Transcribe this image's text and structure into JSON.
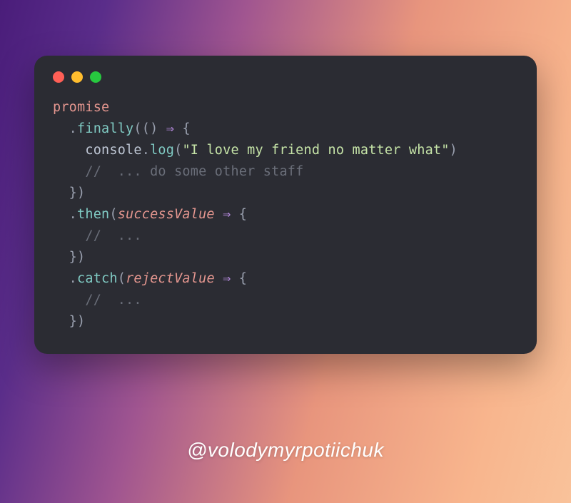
{
  "window": {
    "controls": [
      "red",
      "yellow",
      "green"
    ]
  },
  "code": {
    "l0": {
      "a": "promise"
    },
    "l1": {
      "a": "  .",
      "b": "finally",
      "c": "(() ",
      "d": "⇒",
      "e": " {"
    },
    "l2": {
      "a": "    ",
      "b": "console",
      "c": ".",
      "d": "log",
      "e": "(",
      "f": "\"I love my friend no matter what\"",
      "g": ")"
    },
    "l3": {
      "a": "    ",
      "b": "//  ... do some other staff"
    },
    "l4": {
      "a": "  })"
    },
    "l5": {
      "a": "  .",
      "b": "then",
      "c": "(",
      "d": "successValue",
      "e": " ",
      "f": "⇒",
      "g": " {"
    },
    "l6": {
      "a": "    ",
      "b": "//  ..."
    },
    "l7": {
      "a": "  })"
    },
    "l8": {
      "a": "  .",
      "b": "catch",
      "c": "(",
      "d": "rejectValue",
      "e": " ",
      "f": "⇒",
      "g": " {"
    },
    "l9": {
      "a": "    ",
      "b": "//  ..."
    },
    "l10": {
      "a": "  })"
    }
  },
  "credit": "@volodymyrpotiichuk"
}
